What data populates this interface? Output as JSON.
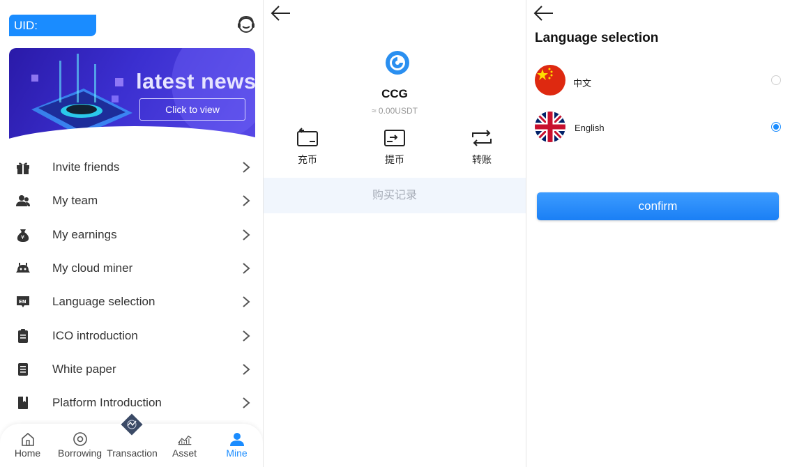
{
  "mine": {
    "uid_label": "UID:",
    "banner": {
      "headline": "latest news",
      "button_label": "Click to view"
    },
    "menu": [
      {
        "label": "Invite friends",
        "icon": "gift-icon"
      },
      {
        "label": "My team",
        "icon": "team-icon"
      },
      {
        "label": "My earnings",
        "icon": "money-bag-icon"
      },
      {
        "label": "My cloud miner",
        "icon": "cloud-miner-icon"
      },
      {
        "label": "Language selection",
        "icon": "language-en-icon"
      },
      {
        "label": "ICO introduction",
        "icon": "document-icon"
      },
      {
        "label": "White paper",
        "icon": "paper-icon"
      },
      {
        "label": "Platform Introduction",
        "icon": "bookmark-book-icon"
      }
    ],
    "tabs": [
      {
        "label": "Home",
        "icon": "home-icon"
      },
      {
        "label": "Borrowing",
        "icon": "target-icon"
      },
      {
        "label": "Transaction",
        "icon": "exchange-diamond-icon"
      },
      {
        "label": "Asset",
        "icon": "chart-icon"
      },
      {
        "label": "Mine",
        "icon": "user-icon",
        "active": true
      }
    ],
    "accent_color": "#1a8cff"
  },
  "asset_detail": {
    "coin_name": "CCG",
    "coin_value": "≈ 0.00USDT",
    "actions": [
      {
        "label": "充币",
        "icon": "deposit-icon"
      },
      {
        "label": "提币",
        "icon": "withdraw-icon"
      },
      {
        "label": "转账",
        "icon": "transfer-icon"
      }
    ],
    "records_label": "购买记录"
  },
  "language": {
    "title": "Language selection",
    "options": [
      {
        "label": "中文",
        "flag": "china-flag-icon",
        "selected": false
      },
      {
        "label": "English",
        "flag": "uk-flag-icon",
        "selected": true
      }
    ],
    "confirm_label": "confirm"
  }
}
